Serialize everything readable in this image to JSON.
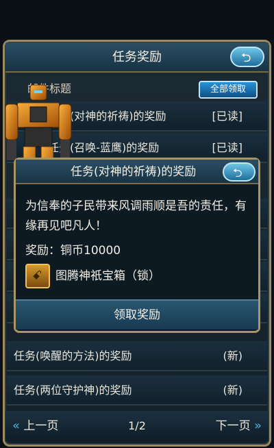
{
  "window": {
    "title": "任务奖励"
  },
  "list": {
    "subheader": "邮件标题",
    "receive_all": "全部领取",
    "rows": [
      {
        "title": "任务(对神的祈祷)的奖励",
        "status": "[已读]"
      },
      {
        "title": "任务(召唤-蓝鹰)的奖励",
        "status": "[已读]"
      },
      {
        "title": "任务(唤醒的方法)的奖励",
        "status": "(新)"
      },
      {
        "title": "任务(两位守护神)的奖励",
        "status": "(新)"
      }
    ]
  },
  "dialog": {
    "title": "任务(对神的祈祷)的奖励",
    "description": "为信奉的子民带来风调雨顺是吾的责任，有缘再见吧凡人！",
    "reward_label": "奖励：铜币10000",
    "item_name": "图腾神祇宝箱（锁）",
    "claim_label": "领取奖励"
  },
  "nav": {
    "prev": "上一页",
    "next": "下一页",
    "page": "1/2"
  },
  "icons": {
    "back": "back-arrow-icon",
    "chest": "treasure-chest-icon"
  }
}
